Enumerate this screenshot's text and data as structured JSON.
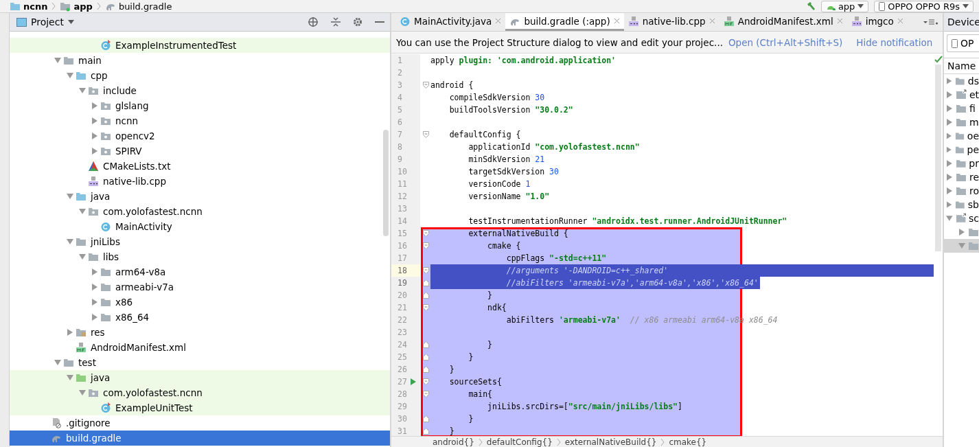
{
  "top_bar": {
    "breadcrumbs": [
      {
        "label": "ncnn",
        "kind": "project"
      },
      {
        "label": "app",
        "kind": "module"
      },
      {
        "label": "build.gradle",
        "kind": "gradle"
      }
    ],
    "run_config": "app",
    "device": "OPPO OPPO R9s"
  },
  "project_panel": {
    "title": "Project",
    "tree": {
      "scrolled_items": [
        {
          "label": "ExampleInstrumentedTest",
          "kind": "test-class",
          "selected": false,
          "test_source": true
        }
      ],
      "src_children": [
        {
          "label": "main",
          "kind": "folder",
          "expanded": true,
          "selected": false,
          "test_source": false,
          "children": [
            {
              "label": "cpp",
              "kind": "source-folder",
              "expanded": true,
              "selected": false,
              "test_source": false,
              "children": [
                {
                  "label": "include",
                  "kind": "package",
                  "expanded": true,
                  "selected": false,
                  "test_source": false,
                  "children": [
                    {
                      "label": "glslang",
                      "kind": "package",
                      "expanded": false,
                      "selected": false,
                      "test_source": false
                    },
                    {
                      "label": "ncnn",
                      "kind": "package",
                      "expanded": false,
                      "selected": false,
                      "test_source": false
                    },
                    {
                      "label": "opencv2",
                      "kind": "package",
                      "expanded": false,
                      "selected": false,
                      "test_source": false
                    },
                    {
                      "label": "SPIRV",
                      "kind": "package",
                      "expanded": false,
                      "selected": false,
                      "test_source": false
                    }
                  ]
                },
                {
                  "label": "CMakeLists.txt",
                  "kind": "cmake",
                  "selected": false,
                  "test_source": false
                },
                {
                  "label": "native-lib.cpp",
                  "kind": "cpp",
                  "selected": false,
                  "test_source": false
                }
              ]
            },
            {
              "label": "java",
              "kind": "source-folder",
              "expanded": true,
              "selected": false,
              "test_source": false,
              "children": [
                {
                  "label": "com.yolofastest.ncnn",
                  "kind": "package",
                  "expanded": true,
                  "selected": false,
                  "test_source": false,
                  "children": [
                    {
                      "label": "MainActivity",
                      "kind": "class",
                      "selected": false,
                      "test_source": false
                    }
                  ]
                }
              ]
            },
            {
              "label": "jniLibs",
              "kind": "folder",
              "expanded": true,
              "selected": false,
              "test_source": false,
              "children": [
                {
                  "label": "libs",
                  "kind": "folder",
                  "expanded": true,
                  "selected": false,
                  "test_source": false,
                  "children": [
                    {
                      "label": "arm64-v8a",
                      "kind": "folder",
                      "expanded": false,
                      "selected": false,
                      "test_source": false
                    },
                    {
                      "label": "armeabi-v7a",
                      "kind": "folder",
                      "expanded": false,
                      "selected": false,
                      "test_source": false
                    },
                    {
                      "label": "x86",
                      "kind": "folder",
                      "expanded": false,
                      "selected": false,
                      "test_source": false
                    },
                    {
                      "label": "x86_64",
                      "kind": "folder",
                      "expanded": false,
                      "selected": false,
                      "test_source": false
                    }
                  ]
                }
              ]
            },
            {
              "label": "res",
              "kind": "res-folder",
              "expanded": false,
              "selected": false,
              "test_source": false
            },
            {
              "label": "AndroidManifest.xml",
              "kind": "manifest",
              "selected": false,
              "test_source": false
            }
          ]
        },
        {
          "label": "test",
          "kind": "folder",
          "expanded": true,
          "selected": false,
          "test_source": false,
          "children": [
            {
              "label": "java",
              "kind": "test-folder",
              "expanded": true,
              "selected": false,
              "test_source": true,
              "children": [
                {
                  "label": "com.yolofastest.ncnn",
                  "kind": "package",
                  "expanded": true,
                  "selected": false,
                  "test_source": true,
                  "children": [
                    {
                      "label": "ExampleUnitTest",
                      "kind": "test-class",
                      "selected": false,
                      "test_source": true
                    }
                  ]
                }
              ]
            }
          ]
        }
      ],
      "module_children": [
        {
          "label": ".gitignore",
          "kind": "gitignore",
          "selected": false,
          "test_source": false
        },
        {
          "label": "build.gradle",
          "kind": "gradle",
          "selected": true,
          "test_source": false
        }
      ]
    }
  },
  "editor": {
    "tabs": [
      {
        "label": "MainActivity.java",
        "kind": "class",
        "selected": false
      },
      {
        "label": "build.gradle (:app)",
        "kind": "gradle",
        "selected": true
      },
      {
        "label": "native-lib.cpp",
        "kind": "cpp",
        "selected": false
      },
      {
        "label": "AndroidManifest.xml",
        "kind": "manifest",
        "selected": false
      },
      {
        "label": "imgco",
        "kind": "header",
        "selected": false
      }
    ],
    "notification": {
      "message": "You can use the Project Structure dialog to view and edit your projec...",
      "actions": [
        "Open (Ctrl+Alt+Shift+S)",
        "Hide notification"
      ]
    },
    "lines": [
      {
        "number": "1",
        "selected": false,
        "current": false,
        "fold_start": false,
        "fold_end": false,
        "runnable": false,
        "tokens": [
          {
            "text": "apply ",
            "kind": "plain"
          },
          {
            "text": "plugin: 'com.android.application'",
            "kind": "string"
          }
        ]
      },
      {
        "number": "2",
        "selected": false,
        "current": false,
        "fold_start": false,
        "fold_end": false,
        "runnable": false
      },
      {
        "number": "3",
        "selected": false,
        "current": false,
        "fold_start": true,
        "fold_end": false,
        "runnable": false,
        "tokens": [
          {
            "text": "android {",
            "kind": "plain"
          }
        ]
      },
      {
        "number": "4",
        "selected": false,
        "current": false,
        "fold_start": false,
        "fold_end": false,
        "runnable": false,
        "tokens": [
          {
            "text": "    compileSdkVersion ",
            "kind": "plain"
          },
          {
            "text": "30",
            "kind": "number"
          }
        ]
      },
      {
        "number": "5",
        "selected": false,
        "current": false,
        "fold_start": false,
        "fold_end": false,
        "runnable": false,
        "tokens": [
          {
            "text": "    buildToolsVersion ",
            "kind": "plain"
          },
          {
            "text": "\"30.0.2\"",
            "kind": "string"
          }
        ]
      },
      {
        "number": "6",
        "selected": false,
        "current": false,
        "fold_start": false,
        "fold_end": false,
        "runnable": false
      },
      {
        "number": "7",
        "selected": false,
        "current": false,
        "fold_start": true,
        "fold_end": false,
        "runnable": false,
        "tokens": [
          {
            "text": "    defaultConfig {",
            "kind": "plain"
          }
        ]
      },
      {
        "number": "8",
        "selected": false,
        "current": false,
        "fold_start": false,
        "fold_end": false,
        "runnable": false,
        "tokens": [
          {
            "text": "        applicationId ",
            "kind": "plain"
          },
          {
            "text": "\"com.yolofastest.ncnn\"",
            "kind": "string"
          }
        ]
      },
      {
        "number": "9",
        "selected": false,
        "current": false,
        "fold_start": false,
        "fold_end": false,
        "runnable": false,
        "tokens": [
          {
            "text": "        minSdkVersion ",
            "kind": "plain"
          },
          {
            "text": "21",
            "kind": "number"
          }
        ]
      },
      {
        "number": "10",
        "selected": false,
        "current": false,
        "fold_start": false,
        "fold_end": false,
        "runnable": false,
        "tokens": [
          {
            "text": "        targetSdkVersion ",
            "kind": "plain"
          },
          {
            "text": "30",
            "kind": "number"
          }
        ]
      },
      {
        "number": "11",
        "selected": false,
        "current": false,
        "fold_start": false,
        "fold_end": false,
        "runnable": false,
        "tokens": [
          {
            "text": "        versionCode ",
            "kind": "plain"
          },
          {
            "text": "1",
            "kind": "number"
          }
        ]
      },
      {
        "number": "12",
        "selected": false,
        "current": false,
        "fold_start": false,
        "fold_end": false,
        "runnable": false,
        "tokens": [
          {
            "text": "        versionName ",
            "kind": "plain"
          },
          {
            "text": "\"1.0\"",
            "kind": "string"
          }
        ]
      },
      {
        "number": "13",
        "selected": false,
        "current": false,
        "fold_start": false,
        "fold_end": false,
        "runnable": false
      },
      {
        "number": "14",
        "selected": false,
        "current": false,
        "fold_start": false,
        "fold_end": false,
        "runnable": false,
        "tokens": [
          {
            "text": "        testInstrumentationRunner ",
            "kind": "plain"
          },
          {
            "text": "\"androidx.test.runner.AndroidJUnitRunner\"",
            "kind": "string"
          }
        ]
      }
    ],
    "annotation": {
      "lines": [
        {
          "number": "15",
          "selected": false,
          "current": false,
          "fold_start": true,
          "fold_end": false,
          "runnable": false,
          "tokens": [
            {
              "text": "        externalNativeBuild {",
              "kind": "plain"
            }
          ]
        },
        {
          "number": "16",
          "selected": false,
          "current": false,
          "fold_start": true,
          "fold_end": false,
          "runnable": false,
          "tokens": [
            {
              "text": "            cmake {",
              "kind": "plain"
            }
          ]
        },
        {
          "number": "17",
          "selected": false,
          "current": false,
          "fold_start": false,
          "fold_end": false,
          "runnable": false,
          "tokens": [
            {
              "text": "                cppFlags ",
              "kind": "plain"
            },
            {
              "text": "\"-std=c++11\"",
              "kind": "string"
            }
          ]
        },
        {
          "number": "18",
          "selected": true,
          "current": true,
          "fold_start": true,
          "fold_end": false,
          "runnable": false,
          "tokens": [
            {
              "text": "                //arguments '-DANDROID=c++_shared'",
              "kind": "comment"
            }
          ]
        },
        {
          "number": "19",
          "selected": true,
          "current": false,
          "fold_start": false,
          "fold_end": true,
          "runnable": false,
          "tokens": [
            {
              "text": "                //abiFilters 'armeabi-v7a','arm64-v8a','x86','x86_64'",
              "kind": "comment"
            }
          ]
        },
        {
          "number": "20",
          "selected": false,
          "current": false,
          "fold_start": false,
          "fold_end": true,
          "runnable": false,
          "tokens": [
            {
              "text": "            }",
              "kind": "plain"
            }
          ]
        },
        {
          "number": "21",
          "selected": false,
          "current": false,
          "fold_start": true,
          "fold_end": false,
          "runnable": false,
          "tokens": [
            {
              "text": "            ndk{",
              "kind": "plain"
            }
          ]
        },
        {
          "number": "22",
          "selected": false,
          "current": false,
          "fold_start": false,
          "fold_end": false,
          "runnable": false,
          "tokens": [
            {
              "text": "                abiFilters ",
              "kind": "plain"
            },
            {
              "text": "'armeabi-v7a'",
              "kind": "string"
            },
            {
              "text": "  // x86 armeabi arm64-v8a x86_64",
              "kind": "comment"
            }
          ]
        },
        {
          "number": "23",
          "selected": false,
          "current": false,
          "fold_start": false,
          "fold_end": false,
          "runnable": false
        },
        {
          "number": "24",
          "selected": false,
          "current": false,
          "fold_start": false,
          "fold_end": true,
          "runnable": false,
          "tokens": [
            {
              "text": "            }",
              "kind": "plain"
            }
          ]
        },
        {
          "number": "25",
          "selected": false,
          "current": false,
          "fold_start": false,
          "fold_end": true,
          "runnable": false,
          "tokens": [
            {
              "text": "        }",
              "kind": "plain"
            }
          ]
        },
        {
          "number": "26",
          "selected": false,
          "current": false,
          "fold_start": false,
          "fold_end": true,
          "runnable": false,
          "tokens": [
            {
              "text": "    }",
              "kind": "plain"
            }
          ]
        },
        {
          "number": "27",
          "selected": false,
          "current": false,
          "fold_start": true,
          "fold_end": false,
          "runnable": true,
          "tokens": [
            {
              "text": "    sourceSets{",
              "kind": "plain"
            }
          ]
        },
        {
          "number": "28",
          "selected": false,
          "current": false,
          "fold_start": true,
          "fold_end": false,
          "runnable": false,
          "tokens": [
            {
              "text": "        main{",
              "kind": "plain"
            }
          ]
        },
        {
          "number": "29",
          "selected": false,
          "current": false,
          "fold_start": false,
          "fold_end": false,
          "runnable": false,
          "tokens": [
            {
              "text": "            jniLibs.srcDirs=[",
              "kind": "plain"
            },
            {
              "text": "\"src/main/jniLibs/libs\"",
              "kind": "string"
            },
            {
              "text": "]",
              "kind": "plain"
            }
          ]
        },
        {
          "number": "30",
          "selected": false,
          "current": false,
          "fold_start": false,
          "fold_end": true,
          "runnable": false,
          "tokens": [
            {
              "text": "        }",
              "kind": "plain"
            }
          ]
        },
        {
          "number": "31",
          "selected": false,
          "current": false,
          "fold_start": false,
          "fold_end": true,
          "runnable": false,
          "tokens": [
            {
              "text": "    }",
              "kind": "plain"
            }
          ]
        }
      ]
    },
    "breadcrumbs": [
      "android{}",
      "defaultConfig{}",
      "externalNativeBuild{}",
      "cmake{}"
    ]
  },
  "device_panel": {
    "title": "Device",
    "device": "OP",
    "column": "Name",
    "rows": [
      {
        "label": "ds",
        "kind": "folder",
        "expanded": false,
        "selected": false
      },
      {
        "label": "et",
        "kind": "link",
        "expanded": false,
        "selected": false
      },
      {
        "label": "fi",
        "kind": "folder",
        "expanded": false,
        "selected": false
      },
      {
        "label": "m",
        "kind": "folder",
        "expanded": false,
        "selected": false
      },
      {
        "label": "oe",
        "kind": "folder",
        "expanded": false,
        "selected": false
      },
      {
        "label": "pe",
        "kind": "folder",
        "expanded": false,
        "selected": false
      },
      {
        "label": "pr",
        "kind": "folder",
        "expanded": false,
        "selected": false
      },
      {
        "label": "re",
        "kind": "folder",
        "expanded": false,
        "selected": false
      },
      {
        "label": "ro",
        "kind": "folder",
        "expanded": false,
        "selected": false
      },
      {
        "label": "sb",
        "kind": "folder",
        "expanded": false,
        "selected": false
      },
      {
        "label": "sc",
        "kind": "link",
        "expanded": true,
        "selected": false,
        "children": [
          {
            "kind": "folder",
            "expanded": false,
            "selected": false
          },
          {
            "kind": "folder",
            "expanded": true,
            "selected": true
          }
        ]
      }
    ]
  }
}
